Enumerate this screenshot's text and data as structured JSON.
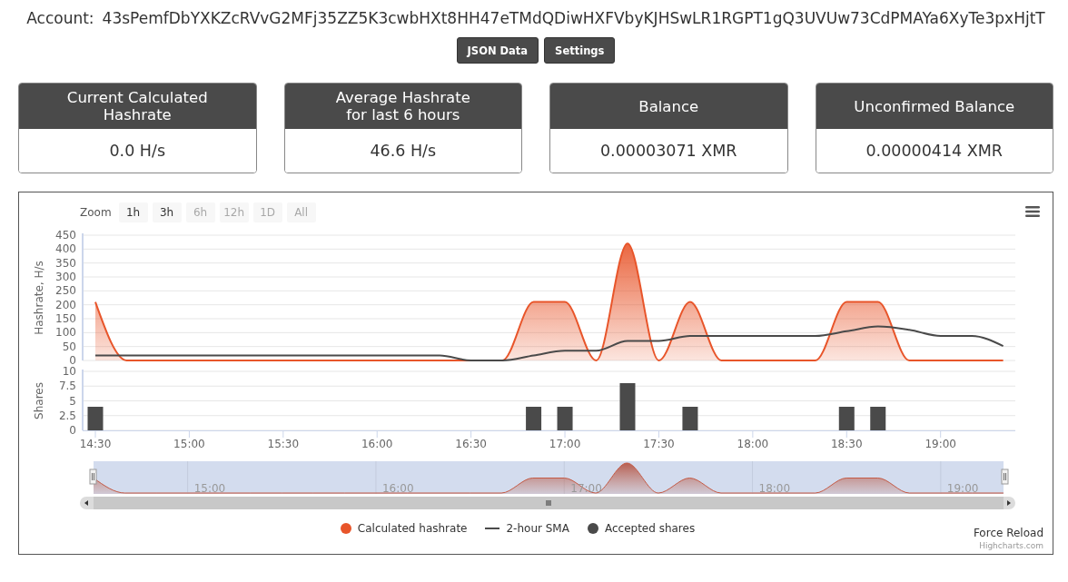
{
  "account": {
    "label": "Account:",
    "address": "43sPemfDbYXKZcRVvG2MFj35ZZ5K3cwbHXt8HH47eTMdQDiwHXFVbyKJHSwLR1RGPT1gQ3UVUw73CdPMAYa6XyTe3pxHjtT"
  },
  "buttons": [
    {
      "label": "JSON Data"
    },
    {
      "label": "Settings"
    }
  ],
  "cards": [
    {
      "title": "Current Calculated\nHashrate",
      "value": "0.0 H/s"
    },
    {
      "title": "Average Hashrate\nfor last 6 hours",
      "value": "46.6 H/s"
    },
    {
      "title": "Balance",
      "value": "0.00003071 XMR"
    },
    {
      "title": "Unconfirmed Balance",
      "value": "0.00000414 XMR"
    }
  ],
  "chart": {
    "zoom_label": "Zoom",
    "zoom_buttons": [
      {
        "label": "1h",
        "disabled": false
      },
      {
        "label": "3h",
        "disabled": false
      },
      {
        "label": "6h",
        "disabled": true
      },
      {
        "label": "12h",
        "disabled": true
      },
      {
        "label": "1D",
        "disabled": true
      },
      {
        "label": "All",
        "disabled": true
      }
    ],
    "hashrate_pane": {
      "chart_data": {
        "type": "area",
        "ylabel": "Hashrate, H/s",
        "grid": true,
        "categories": [
          null,
          null,
          null,
          null,
          null,
          null,
          null,
          null,
          null,
          null,
          null,
          null,
          null,
          null,
          null,
          null,
          null,
          null,
          null,
          null,
          null,
          null,
          null,
          null,
          null,
          null,
          null,
          null,
          null,
          null
        ],
        "series": [
          {
            "name": "Calculated hashrate",
            "color": "#e8552a",
            "values": [
              210,
              0,
              0,
              0,
              0,
              0,
              0,
              0,
              0,
              0,
              0,
              0,
              0,
              0,
              210,
              210,
              0,
              420,
              0,
              210,
              0,
              0,
              0,
              0,
              210,
              210,
              0,
              0,
              0,
              0
            ]
          },
          {
            "name": "2-hour SMA",
            "type": "line",
            "color": "#4a4a4a",
            "values": [
              18,
              18,
              18,
              18,
              18,
              18,
              18,
              18,
              18,
              18,
              18,
              18,
              0,
              0,
              18,
              35,
              35,
              70,
              70,
              88,
              88,
              88,
              88,
              88,
              105,
              122,
              110,
              88,
              88,
              52
            ]
          }
        ],
        "ylim": [
          0,
          450
        ],
        "yticks": [
          0,
          50,
          100,
          150,
          200,
          250,
          300,
          350,
          400,
          450
        ]
      }
    },
    "shares_pane": {
      "chart_data": {
        "type": "bar",
        "ylabel": "Shares",
        "grid": true,
        "categories": [
          "14:30",
          null,
          null,
          "15:00",
          null,
          null,
          "15:30",
          null,
          null,
          "16:00",
          null,
          null,
          "16:30",
          null,
          null,
          "17:00",
          null,
          null,
          "17:30",
          null,
          null,
          "18:00",
          null,
          null,
          "18:30",
          null,
          null,
          "19:00",
          null,
          null
        ],
        "series": [
          {
            "name": "Accepted shares",
            "color": "#4a4a4a",
            "values": [
              4,
              null,
              null,
              null,
              null,
              null,
              null,
              null,
              null,
              null,
              null,
              null,
              null,
              null,
              4,
              4,
              null,
              8,
              null,
              4,
              null,
              null,
              null,
              null,
              4,
              4,
              null,
              null,
              null,
              null
            ]
          }
        ],
        "ylim": [
          0,
          10
        ],
        "yticks": [
          0,
          2.5,
          5,
          7.5,
          10
        ]
      }
    },
    "navigator": {
      "labels": [
        "15:00",
        "16:00",
        "17:00",
        "18:00",
        "19:00"
      ]
    },
    "force_reload": "Force Reload",
    "credit": "Highcharts.com"
  }
}
